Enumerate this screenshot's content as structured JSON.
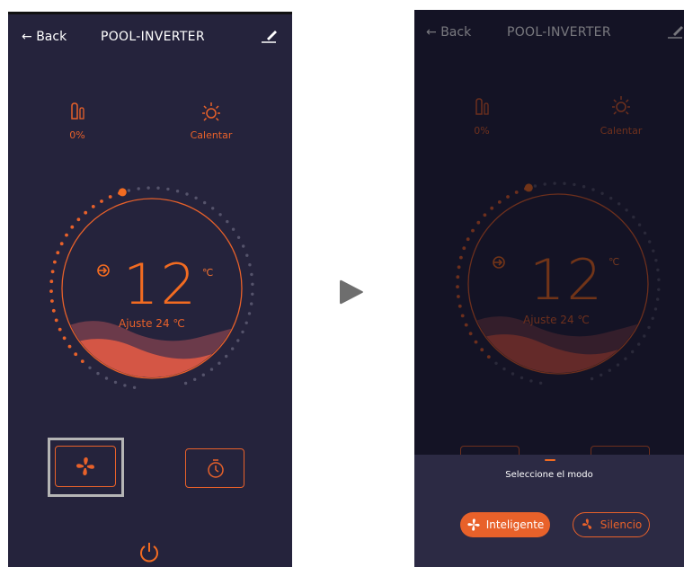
{
  "header": {
    "back_label": "Back",
    "title": "POOL-INVERTER"
  },
  "status": {
    "tank": {
      "icon": "water-tank-icon",
      "value": "0%"
    },
    "mode": {
      "icon": "sun-icon",
      "label": "Calentar"
    }
  },
  "thermostat": {
    "current_temp": "12",
    "unit": "℃",
    "setpoint_label": "Ajuste 24 ℃"
  },
  "controls": {
    "mode_button_icon": "fan-icon",
    "timer_button_icon": "timer-icon",
    "power_icon": "power-icon"
  },
  "mode_sheet": {
    "title": "Seleccione el modo",
    "options": [
      {
        "label": "Inteligente",
        "selected": true
      },
      {
        "label": "Silencio",
        "selected": false
      }
    ]
  },
  "transition_icon": "play-arrow-icon",
  "colors": {
    "background": "#25233c",
    "accent": "#e8612a",
    "wave_light": "#f0654a",
    "wave_dark": "#6b3a4a"
  }
}
